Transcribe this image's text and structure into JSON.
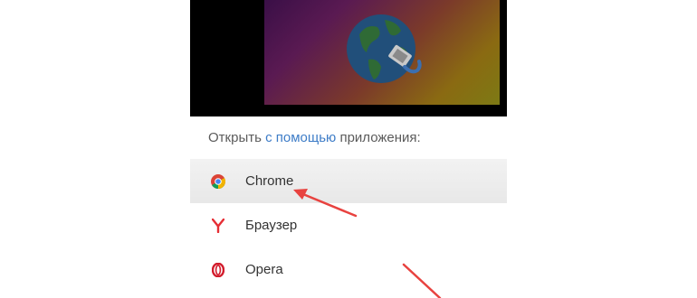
{
  "chooser": {
    "title_prefix": "Открыть ",
    "title_highlight": "с помощью",
    "title_suffix": " приложения:"
  },
  "apps": [
    {
      "label": "Chrome",
      "icon": "chrome-icon",
      "selected": true
    },
    {
      "label": "Браузер",
      "icon": "yandex-browser-icon",
      "selected": false
    },
    {
      "label": "Opera",
      "icon": "opera-icon",
      "selected": false
    }
  ],
  "colors": {
    "accent_title": "#3d7cc7",
    "arrow": "#e8423f",
    "yandex": "#e62e35",
    "opera": "#d21c2c"
  }
}
